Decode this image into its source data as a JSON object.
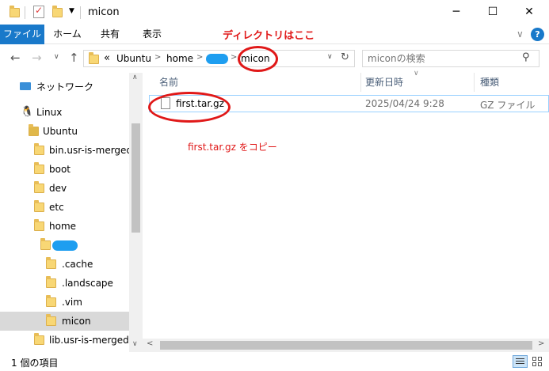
{
  "window": {
    "title": "micon",
    "minimize_glyph": "─",
    "maximize_glyph": "☐",
    "close_glyph": "✕"
  },
  "ribbon": {
    "tabs": [
      "ファイル",
      "ホーム",
      "共有",
      "表示"
    ],
    "help_glyph": "?"
  },
  "annotations": {
    "directory_note": "ディレクトリはここ",
    "copy_note": "first.tar.gz をコピー"
  },
  "address": {
    "prefix": "«",
    "crumbs": [
      "Ubuntu",
      "home",
      "micon"
    ],
    "separator": ">"
  },
  "search": {
    "placeholder": "miconの検索"
  },
  "sidebar": {
    "items": [
      {
        "label": "ネットワーク"
      },
      {
        "label": "Linux"
      },
      {
        "label": "Ubuntu"
      },
      {
        "label": "bin.usr-is-merged"
      },
      {
        "label": "boot"
      },
      {
        "label": "dev"
      },
      {
        "label": "etc"
      },
      {
        "label": "home"
      },
      {
        "label": ".cache"
      },
      {
        "label": ".landscape"
      },
      {
        "label": ".vim"
      },
      {
        "label": "micon"
      },
      {
        "label": "lib.usr-is-merged"
      }
    ]
  },
  "columns": {
    "name": "名前",
    "modified": "更新日時",
    "type": "種類"
  },
  "files": [
    {
      "name": "first.tar.gz",
      "modified": "2025/04/24 9:28",
      "type": "GZ ファイル"
    }
  ],
  "status": {
    "count": "1 個の項目"
  },
  "colors": {
    "accent": "#1979ca",
    "annotation": "#e01818",
    "redaction": "#1e9ef0"
  }
}
